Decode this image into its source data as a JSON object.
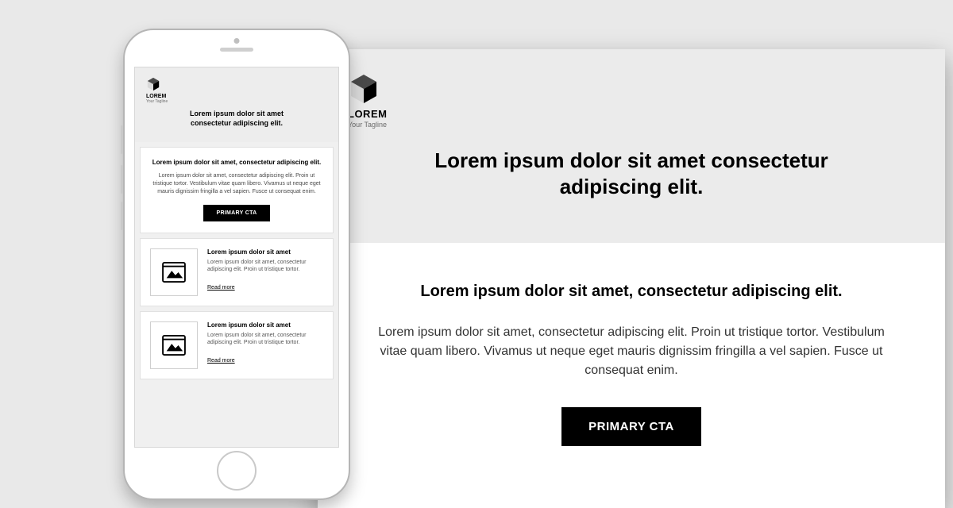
{
  "brand": {
    "name": "LOREM",
    "tagline": "Your Tagline"
  },
  "hero": {
    "headline": "Lorem ipsum dolor sit amet consectetur adipiscing elit."
  },
  "intro": {
    "subheading": "Lorem ipsum dolor sit amet, consectetur adipiscing elit.",
    "paragraph": "Lorem ipsum dolor sit amet, consectetur adipiscing elit. Proin ut tristique tortor. Vestibulum vitae quam libero. Vivamus ut neque eget mauris dignissim fringilla a vel sapien. Fusce ut consequat enim.",
    "cta_label": "PRIMARY CTA"
  },
  "cards": [
    {
      "title": "Lorem ipsum dolor sit amet",
      "body": "Lorem ipsum dolor sit amet, consectetur adipiscing elit. Proin ut tristique tortor.",
      "link_label": "Read more"
    },
    {
      "title": "Lorem ipsum dolor sit amet",
      "body": "Lorem ipsum dolor sit amet, consectetur adipiscing elit. Proin ut tristique tortor.",
      "link_label": "Read more"
    }
  ]
}
